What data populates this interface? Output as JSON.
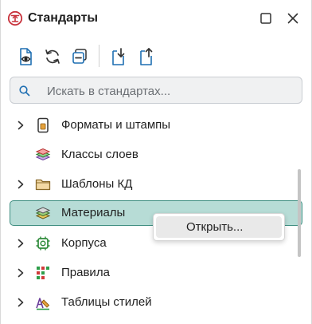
{
  "panel": {
    "title": "Стандарты",
    "app_icon": "standards-icon",
    "header_buttons": [
      "maximize-icon",
      "close-icon"
    ]
  },
  "toolbar": {
    "buttons": [
      "document-view-icon",
      "refresh-icon",
      "collapse-all-icon",
      "import-document-icon",
      "export-document-icon"
    ]
  },
  "search": {
    "placeholder": "Искать в стандартах..."
  },
  "tree": {
    "items": [
      {
        "label": "Форматы и штампы",
        "expandable": true,
        "icon": "document-format-icon"
      },
      {
        "label": "Классы слоев",
        "expandable": false,
        "icon": "layers-icon"
      },
      {
        "label": "Шаблоны КД",
        "expandable": true,
        "icon": "folder-icon"
      },
      {
        "label": "Материалы",
        "expandable": false,
        "icon": "materials-icon",
        "selected": true
      },
      {
        "label": "Корпуса",
        "expandable": true,
        "icon": "chip-package-icon"
      },
      {
        "label": "Правила",
        "expandable": true,
        "icon": "rules-grid-icon"
      },
      {
        "label": "Таблицы стилей",
        "expandable": true,
        "icon": "style-table-icon"
      }
    ]
  },
  "context_menu": {
    "items": [
      "Открыть..."
    ]
  },
  "colors": {
    "selection_bg": "#b7dcd6",
    "selection_border": "#3e8e80",
    "accent_teal": "#2e8b7a",
    "brand_red": "#c8323c"
  }
}
